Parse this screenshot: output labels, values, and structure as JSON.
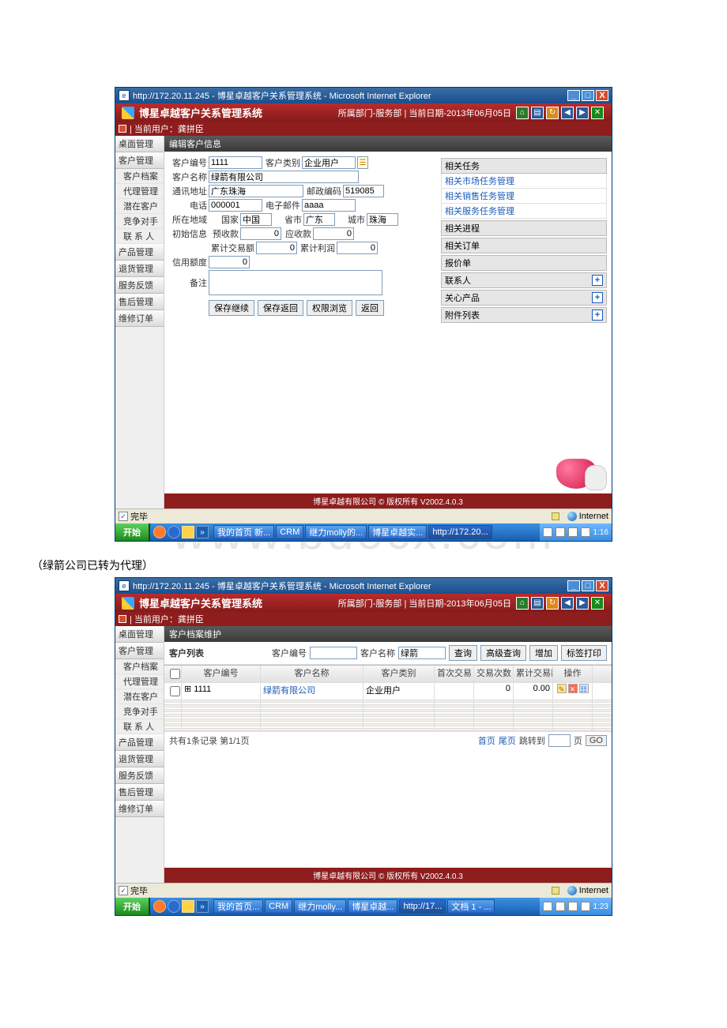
{
  "watermark": "www.bdocx.com",
  "caption": "（绿箭公司已转为代理）",
  "win": {
    "title": "http://172.20.11.245 - 博星卓越客户关系管理系统 - Microsoft Internet Explorer",
    "app_name": "博星卓越客户关系管理系统",
    "dept_info": "所属部门-服务部  |  当前日期-2013年06月05日",
    "userbar": "|  当前用户：龚拼臣"
  },
  "sidebar": {
    "groups": [
      {
        "header": "桌面管理",
        "items": []
      },
      {
        "header": "客户管理",
        "items": [
          "客户档案",
          "代理管理",
          "潜在客户",
          "竞争对手",
          "联 系 人"
        ]
      },
      {
        "header": "产品管理",
        "items": []
      },
      {
        "header": "退货管理",
        "items": []
      },
      {
        "header": "服务反馈",
        "items": []
      },
      {
        "header": "售后管理",
        "items": []
      },
      {
        "header": "维修订单",
        "items": []
      }
    ]
  },
  "shot1": {
    "section": "编辑客户信息",
    "form": {
      "customer_no_lbl": "客户编号",
      "customer_no": "1111",
      "customer_type_lbl": "客户类别",
      "customer_type": "企业用户",
      "customer_name_lbl": "客户名称",
      "customer_name": "绿箭有限公司",
      "address_lbl": "通讯地址",
      "address": "广东珠海",
      "postcode_lbl": "邮政编码",
      "postcode": "519085",
      "phone_lbl": "电话",
      "phone": "000001",
      "email_lbl": "电子邮件",
      "email": "aaaa",
      "region_lbl": "所在地域",
      "country_lbl": "国家",
      "country": "中国",
      "province_lbl": "省市",
      "province": "广东",
      "city_lbl": "城市",
      "city": "珠海",
      "init_lbl": "初始信息",
      "pre_recv_lbl": "预收款",
      "pre_recv": "0",
      "recv_lbl": "应收款",
      "recv": "0",
      "total_amt_lbl": "累计交易额",
      "total_amt": "0",
      "total_profit_lbl": "累计利润",
      "total_profit": "0",
      "credit_lbl": "信用额度",
      "credit": "0",
      "remark_lbl": "备注",
      "remark": "",
      "btn_save_cont": "保存继续",
      "btn_save_back": "保存返回",
      "btn_perm": "权限浏览",
      "btn_back": "返回"
    },
    "related": {
      "tasks_hdr": "相关任务",
      "task_links": [
        "相关市场任务管理",
        "相关销售任务管理",
        "相关服务任务管理"
      ],
      "process_hdr": "相关进程",
      "order_hdr": "相关订单",
      "quote_hdr": "报价单",
      "contact_hdr": "联系人",
      "product_hdr": "关心产品",
      "attach_hdr": "附件列表"
    }
  },
  "shot2": {
    "section": "客户档案维护",
    "list_title": "客户列表",
    "search": {
      "code_lbl": "客户编号",
      "code": "",
      "name_lbl": "客户名称",
      "name": "绿箭",
      "btn_query": "查询",
      "btn_adv": "高级查询",
      "btn_add": "增加",
      "btn_print": "标签打印"
    },
    "columns": {
      "chk": "",
      "code": "客户编号",
      "name": "客户名称",
      "type": "客户类别",
      "first": "首次交易",
      "count": "交易次数",
      "sum": "累计交易额",
      "ops": "操作"
    },
    "rows": [
      {
        "code": "1111",
        "name": "绿箭有限公司",
        "type": "企业用户",
        "first": "",
        "count": "0",
        "sum": "0.00"
      }
    ],
    "pager": {
      "summary": "共有1条记录 第1/1页",
      "first": "首页",
      "last": "尾页",
      "jump": "跳转到",
      "page_suffix": "页",
      "go": "GO",
      "page": ""
    }
  },
  "footer": "博星卓越有限公司 © 版权所有 V2002.4.0.3",
  "status": {
    "done": "完毕",
    "zone": "Internet"
  },
  "taskbar": {
    "start": "开始",
    "tasks1": [
      "我的首页 新...",
      "CRM",
      "继力molly的...",
      "博星卓越实...",
      "http://172.20..."
    ],
    "tasks2": [
      "我的首页...",
      "CRM",
      "继力molly...",
      "博星卓越...",
      "http://17...",
      "文档 1 - ..."
    ],
    "time1": "1:16",
    "time2": "1:23"
  }
}
